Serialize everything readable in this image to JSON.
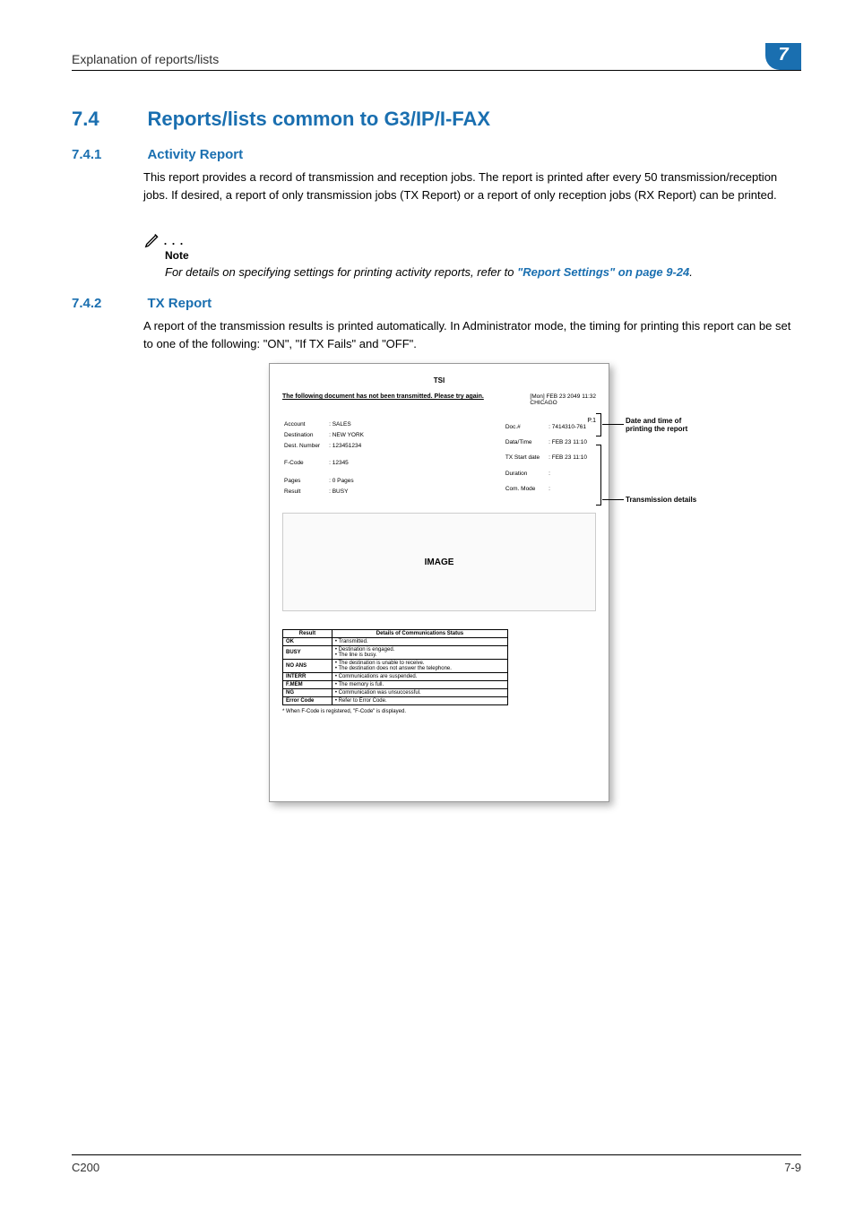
{
  "header": {
    "title": "Explanation of reports/lists",
    "chapter": "7"
  },
  "sec74": {
    "num": "7.4",
    "title": "Reports/lists common to G3/IP/I-FAX"
  },
  "sec741": {
    "num": "7.4.1",
    "title": "Activity Report",
    "body": "This report provides a record of transmission and reception jobs. The report is printed after every 50 transmission/reception jobs. If desired, a report of only transmission jobs (TX Report) or a report of only reception jobs (RX Report) can be printed."
  },
  "note": {
    "label": "Note",
    "body_prefix": "For details on specifying settings for printing activity reports, refer to ",
    "ref": "\"Report Settings\" on page 9-24",
    "body_suffix": "."
  },
  "sec742": {
    "num": "7.4.2",
    "title": "TX Report",
    "body": "A report of the transmission results is printed automatically. In Administrator mode, the timing for printing this report can be set to one of the following: \"ON\", \"If TX Fails\" and \"OFF\"."
  },
  "figure": {
    "tsi": "TSI",
    "msg": "The following document has not been transmitted. Please try again.",
    "page_num": "P.1",
    "date_line1": "[Mon] FEB 23 2049 11:32",
    "date_line2": "CHICAGO",
    "left": {
      "account_l": "Account",
      "account_v": ": SALES",
      "dest_l": "Destination",
      "dest_v": ": NEW YORK",
      "destnum_l": "Dest. Number",
      "destnum_v": ": 123451234",
      "fcode_l": "F-Code",
      "fcode_v": ": 12345",
      "pages_l": "Pages",
      "pages_v": ": 0 Pages",
      "result_l": "Result",
      "result_v": ": BUSY"
    },
    "right": {
      "doc_l": "Doc.#",
      "doc_v": ": 7414310-761",
      "dt_l": "Data/Time",
      "dt_v": ": FEB 23 11:10",
      "txs_l": "TX Start date",
      "txs_v": ": FEB 23 11:10",
      "dur_l": "Duration",
      "dur_v": ":",
      "com_l": "Com. Mode",
      "com_v": ":"
    },
    "image_label": "IMAGE",
    "table": {
      "h1": "Result",
      "h2": "Details of Communications Status",
      "rows": [
        {
          "r": "OK",
          "d": "• Transmitted."
        },
        {
          "r": "BUSY",
          "d": "• Destination is engaged.\n• The line is busy."
        },
        {
          "r": "NO ANS",
          "d": "• The destination is unable to receive.\n• The destination does not answer the telephone."
        },
        {
          "r": "INTERR",
          "d": "• Communications are suspended."
        },
        {
          "r": "F.MEM",
          "d": "• The memory is full."
        },
        {
          "r": "NG",
          "d": "• Communication was unsuccessful."
        },
        {
          "r": "Error Code",
          "d": "• Refer to Error Code."
        }
      ]
    },
    "footnote": "* When F-Code is registered, \"F-Code\" is displayed.",
    "callout1": "Date and time of printing the report",
    "callout2": "Transmission details"
  },
  "footer": {
    "left": "C200",
    "right": "7-9"
  }
}
